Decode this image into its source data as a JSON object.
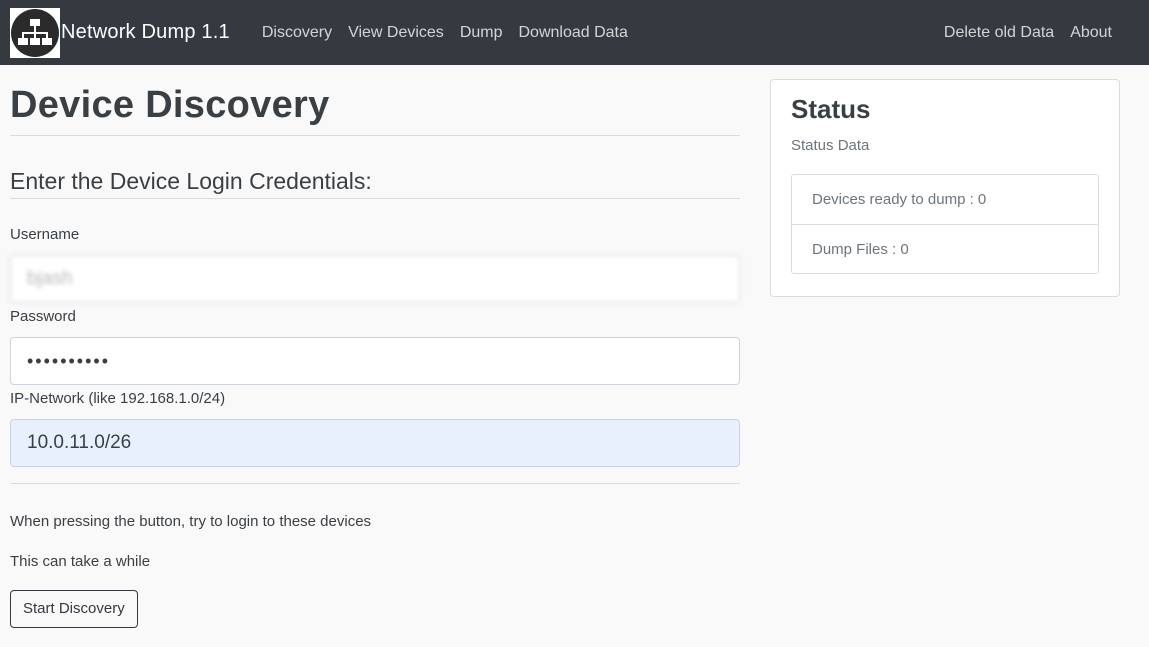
{
  "navbar": {
    "brand": "Network Dump 1.1",
    "logo_icon": "network-topology-icon",
    "left_links": [
      {
        "label": "Discovery"
      },
      {
        "label": "View Devices"
      },
      {
        "label": "Dump"
      },
      {
        "label": "Download Data"
      }
    ],
    "right_links": [
      {
        "label": "Delete old Data"
      },
      {
        "label": "About"
      }
    ]
  },
  "main": {
    "title": "Device Discovery",
    "section_title": "Enter the Device Login Credentials:",
    "username_label": "Username",
    "username_value": "bjash",
    "password_label": "Password",
    "password_value": "••••••••••",
    "network_label": "IP-Network (like 192.168.1.0/24)",
    "network_value": "10.0.11.0/26",
    "info_text_1": "When pressing the button, try to login to these devices",
    "info_text_2": "This can take a while",
    "start_button": "Start Discovery"
  },
  "status": {
    "title": "Status",
    "subtitle": "Status Data",
    "items": [
      {
        "label": "Devices ready to dump : 0"
      },
      {
        "label": "Dump Files : 0"
      }
    ]
  },
  "colors": {
    "navbar_bg": "#343a40",
    "page_bg": "#f9f9f9",
    "autofill_bg": "#e8f0fe"
  }
}
